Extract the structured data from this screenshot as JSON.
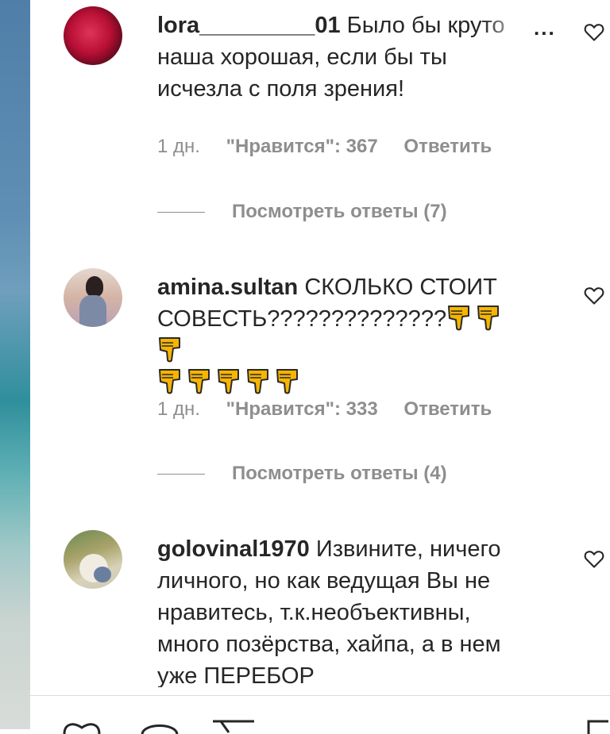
{
  "comments": [
    {
      "username": "lora_________01",
      "text_lines": [
        "Было бы круто",
        "наша хорошая, если бы ты",
        "исчезла с поля зрения!"
      ],
      "time": "1 дн.",
      "likes": "\"Нравится\": 367",
      "reply": "Ответить",
      "view_replies": "Посмотреть ответы (7)",
      "more": "..."
    },
    {
      "username": "amina.sultan",
      "text_lines": [
        "СКОЛЬКО СТОИТ",
        "СОВЕСТЬ??????????????"
      ],
      "emoji": "thumbs-down-icon",
      "emoji_count": 8,
      "time": "1 дн.",
      "likes": "\"Нравится\": 333",
      "reply": "Ответить",
      "view_replies": "Посмотреть ответы (4)"
    },
    {
      "username": "golovinal1970",
      "text_lines": [
        "Извините, ничего",
        "личного, но как ведущая Вы не",
        "нравитесь, т.к.необъективны,",
        "много позёрства, хайпа, а в нем",
        "уже ПЕРЕБОР"
      ]
    }
  ],
  "colors": {
    "text": "#262626",
    "secondary": "#8e8e8e",
    "emoji": "#f7b500"
  }
}
